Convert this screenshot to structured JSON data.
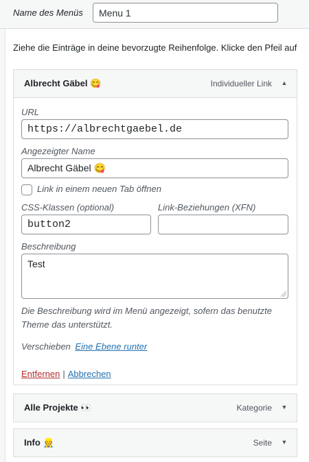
{
  "menu_settings": {
    "name_label": "Name des Menüs",
    "name_value": "Menu 1"
  },
  "instructions": "Ziehe die Einträge in deine bevorzugte Reihenfolge. Klicke den Pfeil auf",
  "items": [
    {
      "title": "Albrecht Gäbel",
      "emoji": "😋",
      "type": "Individueller Link",
      "expanded": true,
      "arrow": "▲",
      "fields": {
        "url_label": "URL",
        "url_value": "https://albrechtgaebel.de",
        "nav_label_label": "Angezeigter Name",
        "nav_label_value": "Albrecht Gäbel 😋",
        "new_tab_label": "Link in einem neuen Tab öffnen",
        "new_tab_checked": false,
        "css_classes_label": "CSS-Klassen (optional)",
        "css_classes_value": "button2",
        "xfn_label": "Link-Beziehungen (XFN)",
        "xfn_value": "",
        "description_label": "Beschreibung",
        "description_value": "Test",
        "description_note": "Die Beschreibung wird im Menü angezeigt, sofern das benutzte Theme das unterstützt.",
        "move_label": "Verschieben",
        "move_link": "Eine Ebene runter",
        "remove_link": "Entfernen",
        "separator": "|",
        "cancel_link": "Abbrechen"
      }
    },
    {
      "title": "Alle Projekte",
      "emoji": "👀",
      "type": "Kategorie",
      "expanded": false,
      "arrow": "▼"
    },
    {
      "title": "Info",
      "emoji": "👷",
      "type": "Seite",
      "expanded": false,
      "arrow": "▼"
    }
  ],
  "colors": {
    "link": "#2271b1",
    "remove": "#b32d2e",
    "border": "#dcdcde",
    "panel_bg": "#f6f7f7"
  }
}
